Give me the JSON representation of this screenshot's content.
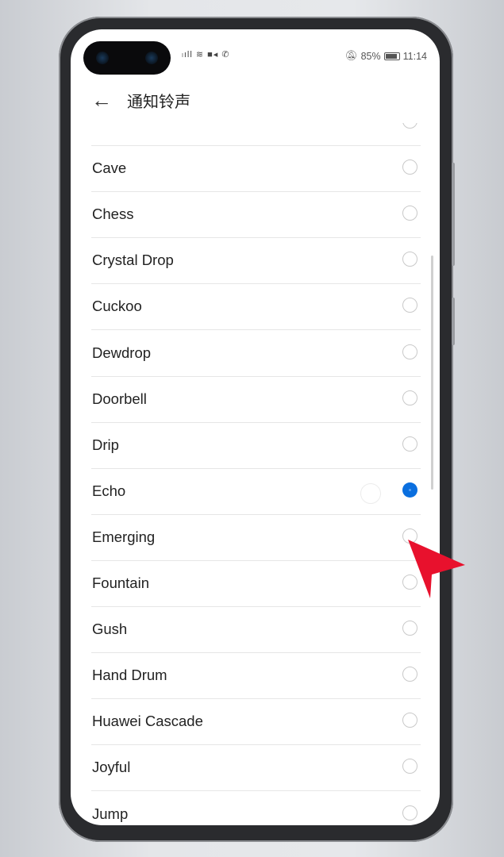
{
  "status_bar": {
    "left_icons": [
      "signal-icon",
      "wifi-icon",
      "video-call-icon",
      "wifi-call-icon"
    ],
    "signal_text": "⁴ᴳ",
    "battery": "85%",
    "time": "11:14",
    "mute_icon": "bell-off-icon"
  },
  "header": {
    "title": "通知铃声",
    "back_icon": "arrow-left-icon"
  },
  "list": {
    "items": [
      {
        "label": "",
        "selected": false
      },
      {
        "label": "Cave",
        "selected": false
      },
      {
        "label": "Chess",
        "selected": false
      },
      {
        "label": "Crystal Drop",
        "selected": false
      },
      {
        "label": "Cuckoo",
        "selected": false
      },
      {
        "label": "Dewdrop",
        "selected": false
      },
      {
        "label": "Doorbell",
        "selected": false
      },
      {
        "label": "Drip",
        "selected": false
      },
      {
        "label": "Echo",
        "selected": true
      },
      {
        "label": "Emerging",
        "selected": false
      },
      {
        "label": "Fountain",
        "selected": false
      },
      {
        "label": "Gush",
        "selected": false
      },
      {
        "label": "Hand Drum",
        "selected": false
      },
      {
        "label": "Huawei Cascade",
        "selected": false
      },
      {
        "label": "Joyful",
        "selected": false
      },
      {
        "label": "Jump",
        "selected": false
      }
    ]
  },
  "colors": {
    "accent": "#0a6fdf",
    "pointer": "#e8112d"
  }
}
